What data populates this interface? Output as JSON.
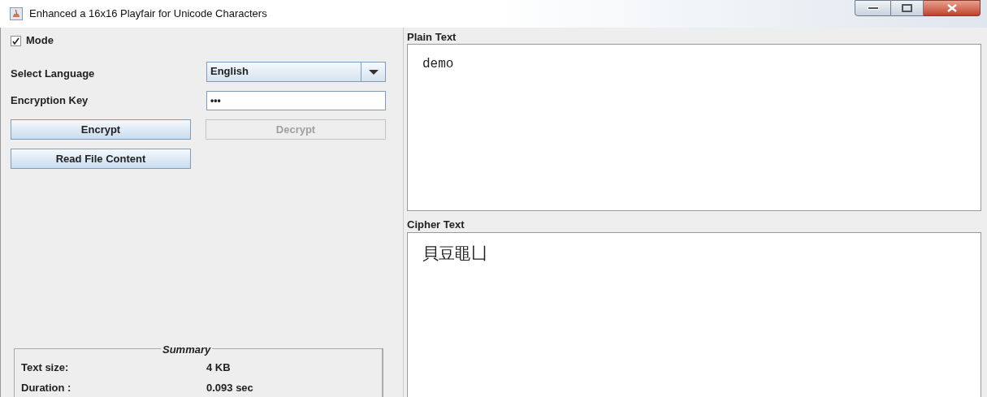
{
  "window": {
    "title": "Enhanced a 16x16 Playfair for Unicode Characters"
  },
  "mode": {
    "label": "Mode",
    "checked": true
  },
  "language": {
    "label": "Select Language",
    "value": "English"
  },
  "key": {
    "label": "Encryption Key",
    "value": "•••"
  },
  "buttons": [
    {
      "label": "Encrypt",
      "disabled": false
    },
    {
      "label": "Decrypt",
      "disabled": true
    }
  ],
  "read_button": {
    "label": "Read File Content"
  },
  "summary": {
    "title": "Summary",
    "rows": [
      {
        "label": "Text size:",
        "value": "4 KB"
      },
      {
        "label": "Duration :",
        "value": "0.093 sec"
      }
    ]
  },
  "plain": {
    "label": "Plain Text",
    "value": "demo"
  },
  "cipher": {
    "label": "Cipher Text",
    "value": "貝豆黽凵"
  }
}
